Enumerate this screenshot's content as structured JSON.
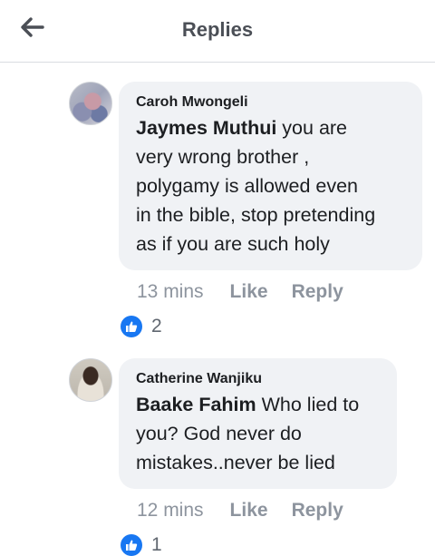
{
  "header": {
    "title": "Replies",
    "back_icon": "arrow-left-icon"
  },
  "comments": [
    {
      "author": "Caroh Mwongeli",
      "mention": "Jaymes Muthui",
      "text_lines": [
        " you are",
        "very wrong brother ,",
        "polygamy is allowed even",
        "in the bible, stop pretending",
        "as if you are such holy"
      ],
      "time": "13 mins",
      "like_label": "Like",
      "reply_label": "Reply",
      "reaction_count": "2"
    },
    {
      "author": "Catherine Wanjiku",
      "mention": "Baake Fahim",
      "text_lines": [
        " Who lied to",
        "you? God never do",
        "mistakes..never be lied"
      ],
      "time": "12 mins",
      "like_label": "Like",
      "reply_label": "Reply",
      "reaction_count": "1"
    }
  ],
  "colors": {
    "bubble": "#f0f2f5",
    "muted_text": "#8d949e",
    "like_blue": "#1877f2",
    "title": "#4b4f56"
  }
}
